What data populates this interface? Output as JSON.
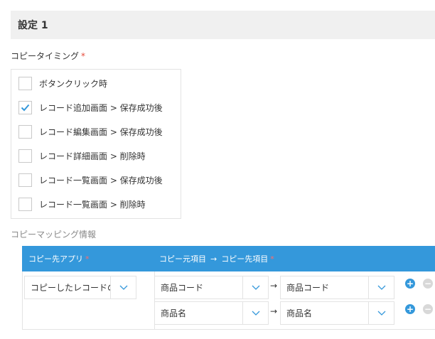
{
  "section": {
    "title": "設定 1"
  },
  "timing": {
    "label": "コピータイミング",
    "required_mark": "*",
    "options": [
      {
        "label": "ボタンクリック時",
        "checked": false
      },
      {
        "label": "レコード追加画面 > 保存成功後",
        "checked": true
      },
      {
        "label": "レコード編集画面 > 保存成功後",
        "checked": false
      },
      {
        "label": "レコード詳細画面 > 削除時",
        "checked": false
      },
      {
        "label": "レコード一覧画面 > 保存成功後",
        "checked": false
      },
      {
        "label": "レコード一覧画面 > 削除時",
        "checked": false
      }
    ]
  },
  "mapping": {
    "label": "コピーマッピング情報",
    "headers": {
      "dest_app": "コピー先アプリ",
      "src_field": "コピー元項目",
      "arrow": "→",
      "dest_field": "コピー先項目",
      "required_mark": "*"
    },
    "dest_app_value": "コピーしたレコードの",
    "rows": [
      {
        "source": "商品コード",
        "arrow": "→",
        "target": "商品コード"
      },
      {
        "source": "商品名",
        "arrow": "→",
        "target": "商品名"
      }
    ],
    "add_symbol": "+",
    "remove_symbol": "−"
  },
  "colors": {
    "accent": "#3498db",
    "required": "#e74c3c",
    "header_bg": "#f0f0f0"
  }
}
